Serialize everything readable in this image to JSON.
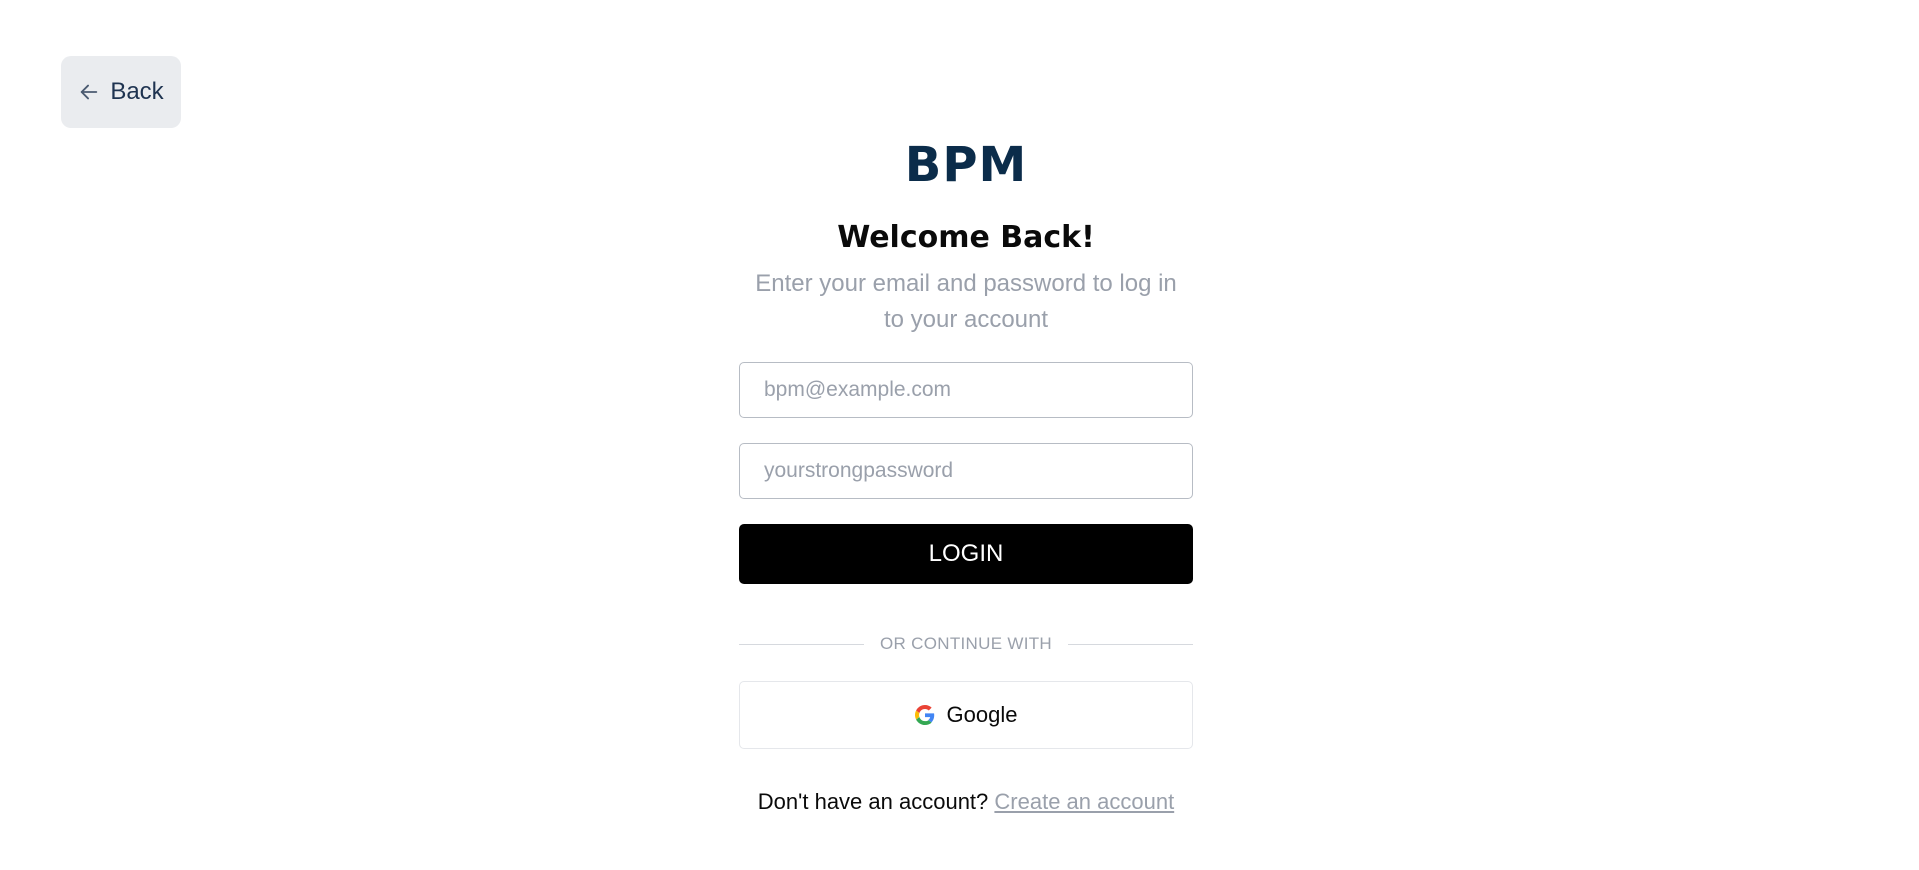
{
  "header": {
    "back_label": "Back",
    "back_icon": "arrow-left-icon"
  },
  "brand": {
    "logo_text": "BPM",
    "color": "#0b2c4a"
  },
  "login_form": {
    "title": "Welcome Back!",
    "subtitle_line1": "Enter your email and password to log in",
    "subtitle_line2": "to your account",
    "email": {
      "value": "",
      "placeholder": "bpm@example.com"
    },
    "password": {
      "value": "",
      "placeholder": "yourstrongpassword"
    },
    "login_label": "LOGIN",
    "divider_text": "OR CONTINUE WITH",
    "google_label": "Google",
    "google_icon": "google-icon",
    "signup_prompt": "Don't have an account?",
    "signup_link": "Create an account"
  },
  "colors": {
    "primary_button": "#000000",
    "back_button_bg": "#eaecef",
    "muted_text": "#9aa0ab"
  }
}
